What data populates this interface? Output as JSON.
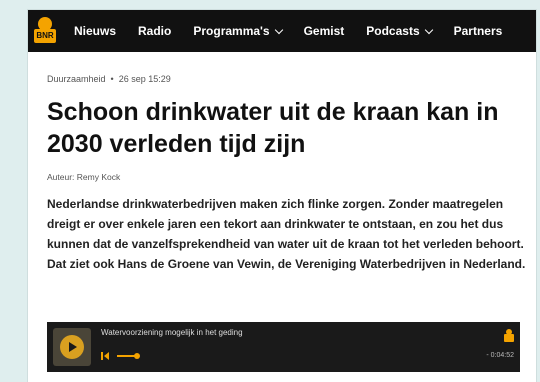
{
  "nav": {
    "logo_text": "BNR",
    "items": [
      {
        "label": "Nieuws",
        "has_dropdown": false
      },
      {
        "label": "Radio",
        "has_dropdown": false
      },
      {
        "label": "Programma's",
        "has_dropdown": true
      },
      {
        "label": "Gemist",
        "has_dropdown": false
      },
      {
        "label": "Podcasts",
        "has_dropdown": true
      },
      {
        "label": "Partners",
        "has_dropdown": false
      }
    ]
  },
  "article": {
    "category": "Duurzaamheid",
    "date": "26 sep 15:29",
    "title": "Schoon drinkwater uit de kraan kan in 2030 verleden tijd zijn",
    "author": "Auteur: Remy Kock",
    "lead": "Nederlandse drinkwaterbedrijven maken zich flinke zorgen. Zonder maatregelen dreigt er over enkele jaren een tekort aan drinkwater te ontstaan, en zou het dus kunnen dat de vanzelfsprekendheid van water uit de kraan tot het verleden behoort. Dat ziet ook Hans de Groene van Vewin, de Vereniging Waterbedrijven in Nederland."
  },
  "player": {
    "title": "Watervoorziening mogelijk in het geding",
    "time_remaining": "- 0:04:52"
  },
  "colors": {
    "accent": "#f4a300",
    "nav_bg": "#111111",
    "page_bg": "#dfeeee"
  }
}
